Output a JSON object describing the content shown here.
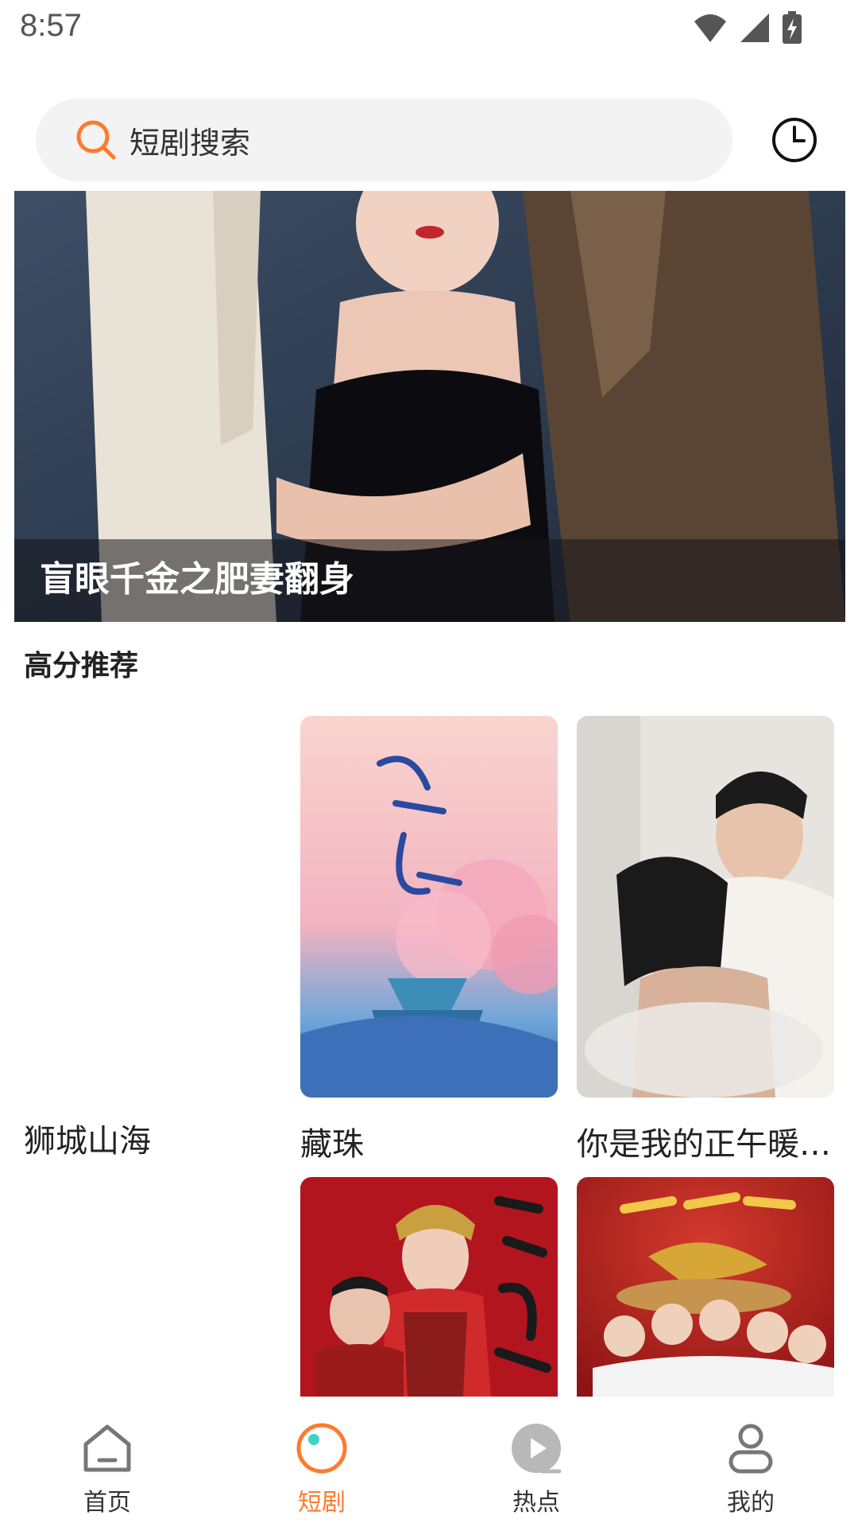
{
  "status_bar": {
    "time": "8:57"
  },
  "search": {
    "placeholder": "短剧搜索"
  },
  "banner": {
    "title": "盲眼千金之肥妻翻身"
  },
  "section": {
    "title": "高分推荐"
  },
  "cards": [
    {
      "title": "狮城山海"
    },
    {
      "title": "藏珠"
    },
    {
      "title": "你是我的正午暖…"
    },
    {
      "title": ""
    },
    {
      "title": ""
    },
    {
      "title": ""
    }
  ],
  "tabs": [
    {
      "label": "首页",
      "icon": "home-icon",
      "active": false
    },
    {
      "label": "短剧",
      "icon": "short-drama-icon",
      "active": true
    },
    {
      "label": "热点",
      "icon": "play-icon",
      "active": false
    },
    {
      "label": "我的",
      "icon": "profile-icon",
      "active": false
    }
  ],
  "colors": {
    "accent": "#ff7a2f",
    "icon_gray": "#bbbbbb"
  }
}
